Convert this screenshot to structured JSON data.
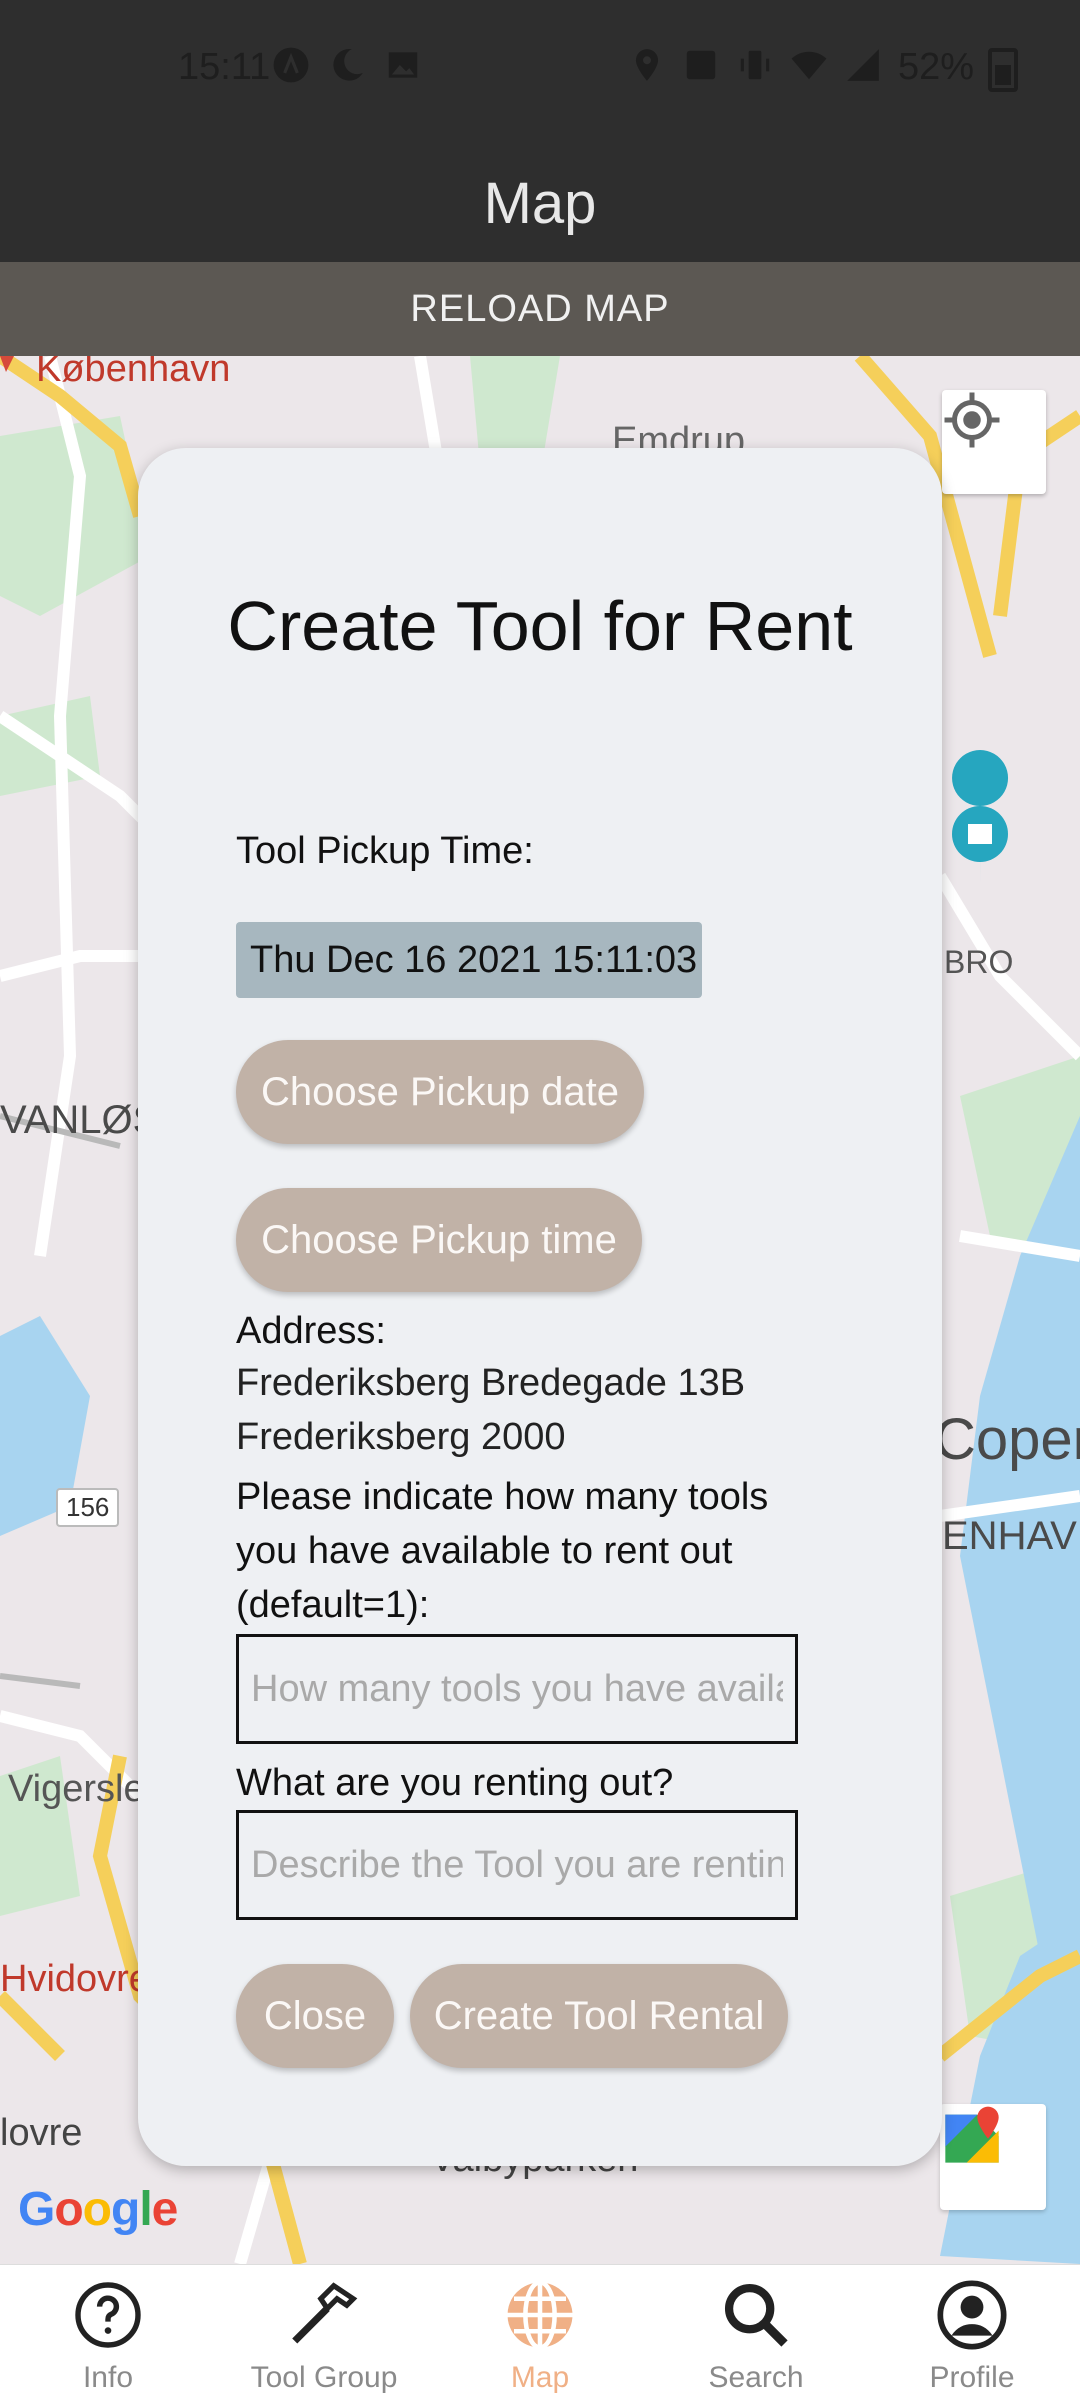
{
  "status_bar": {
    "time": "15:11",
    "battery_percent": "52%"
  },
  "header": {
    "title": "Map"
  },
  "reload_label": "RELOAD MAP",
  "map": {
    "labels": {
      "kobenhavn": "København",
      "emdrup": "Emdrup",
      "bro": "BRO",
      "vanlos": "VANLØS",
      "copenhagen": "Copen",
      "enhav": "ENHAV",
      "vigerslev": "Vigerslev",
      "hvidovre": "Hvidovre",
      "ovre": "lovre",
      "valbyparken": "Valbyparken",
      "road_number": "156"
    },
    "google_logo": [
      "G",
      "o",
      "o",
      "g",
      "l",
      "e"
    ]
  },
  "modal": {
    "title": "Create Tool for Rent",
    "pickup_time_label": "Tool Pickup Time:",
    "pickup_time_value": "Thu Dec 16 2021 15:11:03",
    "choose_date_label": "Choose Pickup date",
    "choose_time_label": "Choose Pickup time",
    "address_label": "Address:",
    "address_line1": "Frederiksberg Bredegade 13B",
    "address_line2": "Frederiksberg 2000",
    "quantity_question": "Please indicate how many tools you have available to rent out (default=1):",
    "quantity_placeholder": "How many tools you have available",
    "description_question": "What are you renting out?",
    "description_placeholder": "Describe the Tool you are renting out",
    "close_label": "Close",
    "create_label": "Create Tool Rental"
  },
  "bottom_nav": {
    "items": [
      {
        "label": "Info",
        "icon": "help-circle-icon"
      },
      {
        "label": "Tool Group",
        "icon": "hammer-icon"
      },
      {
        "label": "Map",
        "icon": "globe-icon",
        "active": true
      },
      {
        "label": "Search",
        "icon": "search-icon"
      },
      {
        "label": "Profile",
        "icon": "account-circle-icon"
      }
    ]
  },
  "colors": {
    "accent": "#f0b086",
    "button": "#c1b2a7",
    "header": "#2e2e2e"
  }
}
